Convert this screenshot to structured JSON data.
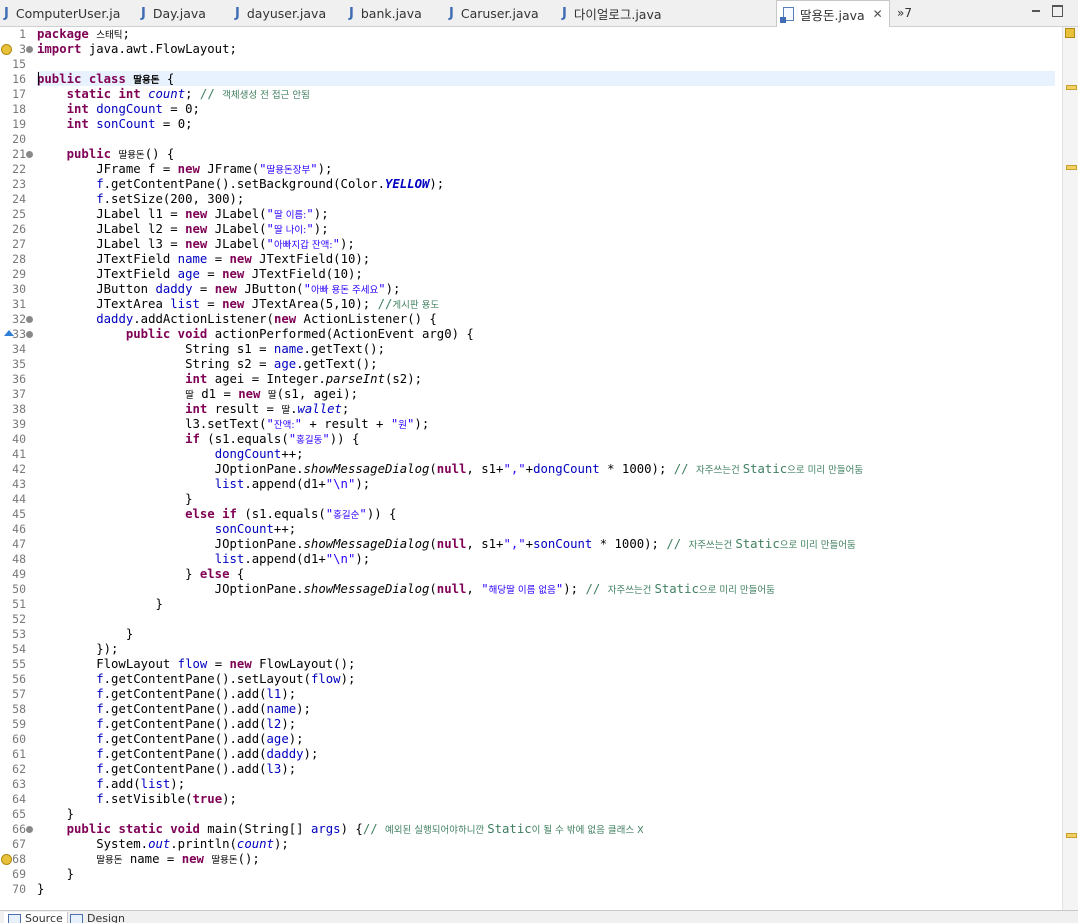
{
  "tabs": [
    {
      "label": "ComputerUser.ja",
      "active": false
    },
    {
      "label": "Day.java",
      "active": false
    },
    {
      "label": "dayuser.java",
      "active": false
    },
    {
      "label": "bank.java",
      "active": false
    },
    {
      "label": "Caruser.java",
      "active": false
    },
    {
      "label": "다이얼로그.java",
      "active": false
    },
    {
      "label": "딸용돈.java",
      "active": true
    }
  ],
  "tab_overflow": "»7",
  "tab_close_glyph": "✕",
  "java_icon_glyph": "J",
  "bottom_tabs": [
    {
      "label": "Source",
      "active": true
    },
    {
      "label": "Design",
      "active": false
    }
  ],
  "line_numbers": [
    "1",
    "3",
    "15",
    "16",
    "17",
    "18",
    "19",
    "20",
    "21",
    "22",
    "23",
    "24",
    "25",
    "26",
    "27",
    "28",
    "29",
    "30",
    "31",
    "32",
    "33",
    "34",
    "35",
    "36",
    "37",
    "38",
    "39",
    "40",
    "41",
    "42",
    "43",
    "44",
    "45",
    "46",
    "47",
    "48",
    "49",
    "50",
    "51",
    "52",
    "53",
    "54",
    "55",
    "56",
    "57",
    "58",
    "59",
    "60",
    "61",
    "62",
    "63",
    "64",
    "65",
    "66",
    "67",
    "68",
    "69",
    "70"
  ],
  "code": {
    "l1": [
      "package",
      " ",
      "스태틱",
      ";"
    ],
    "l3": [
      "import",
      " java.awt.FlowLayout;"
    ],
    "l16": [
      "public",
      " ",
      "class",
      " ",
      "딸용돈",
      " {"
    ],
    "l17": [
      "    ",
      "static",
      " ",
      "int",
      " ",
      "count",
      "; ",
      "// ",
      "객체생성 전 접근 안됨"
    ],
    "l18": [
      "    ",
      "int",
      " ",
      "dongCount",
      " = 0;"
    ],
    "l19": [
      "    ",
      "int",
      " ",
      "sonCount",
      " = 0;"
    ],
    "l21": [
      "    ",
      "public",
      " ",
      "딸용돈",
      "() {"
    ],
    "l22": [
      "        JFrame f = ",
      "new",
      " JFrame(",
      "\"",
      "딸용돈장부",
      "\"",
      ");"
    ],
    "l23": [
      "        ",
      "f",
      ".getContentPane().setBackground(Color.",
      "YELLOW",
      ");"
    ],
    "l24": [
      "        ",
      "f",
      ".setSize(200, 300);"
    ],
    "l25": [
      "        JLabel l1 = ",
      "new",
      " JLabel(",
      "\"",
      "딸 이름:",
      "\"",
      ");"
    ],
    "l26": [
      "        JLabel l2 = ",
      "new",
      " JLabel(",
      "\"",
      "딸 나이:",
      "\"",
      ");"
    ],
    "l27": [
      "        JLabel l3 = ",
      "new",
      " JLabel(",
      "\"",
      "아빠지갑 잔액:",
      "\"",
      ");"
    ],
    "l28": [
      "        JTextField ",
      "name",
      " = ",
      "new",
      " JTextField(10);"
    ],
    "l29": [
      "        JTextField ",
      "age",
      " = ",
      "new",
      " JTextField(10);"
    ],
    "l30": [
      "        JButton ",
      "daddy",
      " = ",
      "new",
      " JButton(",
      "\"",
      "아빠 용돈 주세요",
      "\"",
      ");"
    ],
    "l31": [
      "        JTextArea ",
      "list",
      " = ",
      "new",
      " JTextArea(5,10); ",
      "//",
      "게시판 용도"
    ],
    "l32": [
      "        ",
      "daddy",
      ".addActionListener(",
      "new",
      " ActionListener() {"
    ],
    "l33": [
      "            ",
      "public",
      " ",
      "void",
      " actionPerformed(ActionEvent arg0) {"
    ],
    "l34": [
      "                    String s1 = ",
      "name",
      ".getText();"
    ],
    "l35": [
      "                    String s2 = ",
      "age",
      ".getText();"
    ],
    "l36": [
      "                    ",
      "int",
      " agei = Integer.",
      "parseInt",
      "(s2);"
    ],
    "l37": [
      "                    ",
      "딸",
      " d1 = ",
      "new",
      " ",
      "딸",
      "(s1, agei);"
    ],
    "l38": [
      "                    ",
      "int",
      " result = ",
      "딸",
      ".",
      "wallet",
      ";"
    ],
    "l39": [
      "                    l3.setText(",
      "\"",
      "잔액:",
      "\"",
      " + result + ",
      "\"",
      "원",
      "\"",
      ");"
    ],
    "l40": [
      "                    ",
      "if",
      " (s1.equals(",
      "\"",
      "홍길동",
      "\"",
      ")) {"
    ],
    "l41": [
      "                        ",
      "dongCount",
      "++;"
    ],
    "l42": [
      "                        JOptionPane.",
      "showMessageDialog",
      "(",
      "null",
      ", s1+",
      "\",\"",
      "+",
      "dongCount",
      " * 1000); ",
      "// ",
      "자주쓰는건 ",
      "Static",
      "으로 미리 만들어둠"
    ],
    "l43": [
      "                        ",
      "list",
      ".append(d1+",
      "\"\\n\"",
      ");"
    ],
    "l44": [
      "                    }"
    ],
    "l45": [
      "                    ",
      "else",
      " ",
      "if",
      " (s1.equals(",
      "\"",
      "홍길순",
      "\"",
      ")) {"
    ],
    "l46": [
      "                        ",
      "sonCount",
      "++;"
    ],
    "l47": [
      "                        JOptionPane.",
      "showMessageDialog",
      "(",
      "null",
      ", s1+",
      "\",\"",
      "+",
      "sonCount",
      " * 1000); ",
      "// ",
      "자주쓰는건 ",
      "Static",
      "으로 미리 만들어둠"
    ],
    "l48": [
      "                        ",
      "list",
      ".append(d1+",
      "\"\\n\"",
      ");"
    ],
    "l49": [
      "                    } ",
      "else",
      " {"
    ],
    "l50": [
      "                        JOptionPane.",
      "showMessageDialog",
      "(",
      "null",
      ", ",
      "\"",
      "해당딸 이름 없음",
      "\"",
      "); ",
      "// ",
      "자주쓰는건 ",
      "Static",
      "으로 미리 만들어둠"
    ],
    "l51": [
      "                }"
    ],
    "l52": [
      ""
    ],
    "l53": [
      "            }"
    ],
    "l54": [
      "        });"
    ],
    "l55": [
      "        FlowLayout ",
      "flow",
      " = ",
      "new",
      " FlowLayout();"
    ],
    "l56": [
      "        ",
      "f",
      ".getContentPane().setLayout(",
      "flow",
      ");"
    ],
    "l57": [
      "        ",
      "f",
      ".getContentPane().add(",
      "l1",
      ");"
    ],
    "l58": [
      "        ",
      "f",
      ".getContentPane().add(",
      "name",
      ");"
    ],
    "l59": [
      "        ",
      "f",
      ".getContentPane().add(",
      "l2",
      ");"
    ],
    "l60": [
      "        ",
      "f",
      ".getContentPane().add(",
      "age",
      ");"
    ],
    "l61": [
      "        ",
      "f",
      ".getContentPane().add(",
      "daddy",
      ");"
    ],
    "l62": [
      "        ",
      "f",
      ".getContentPane().add(",
      "l3",
      ");"
    ],
    "l63": [
      "        ",
      "f",
      ".add(",
      "list",
      ");"
    ],
    "l64": [
      "        ",
      "f",
      ".setVisible(",
      "true",
      ");"
    ],
    "l65": [
      "    }"
    ],
    "l66": [
      "    ",
      "public",
      " ",
      "static",
      " ",
      "void",
      " main(String[] ",
      "args",
      ") {",
      "// ",
      "예외된 실행되어야하니깐 ",
      "Static",
      "이 될 수 밖에 없음 클래스 X"
    ],
    "l67": [
      "        System.",
      "out",
      ".println(",
      "count",
      ");"
    ],
    "l68": [
      "        ",
      "딸용돈",
      " ",
      "name",
      " = ",
      "new",
      " ",
      "딸용돈",
      "();"
    ],
    "l69": [
      "    }"
    ],
    "l70": [
      "}"
    ]
  },
  "colors": {
    "keyword": "#7f0055",
    "string": "#2a00ff",
    "comment": "#3f7f5f",
    "field": "#0000c0",
    "current_line": "#e8f2fe"
  },
  "icons": {
    "tab_java": "java-file-icon",
    "tab_active": "class-file-icon",
    "gutter_bulb": "lightbulb-warning-icon",
    "gutter_override": "override-triangle-icon",
    "minimize": "minimize-icon",
    "maximize": "maximize-icon"
  }
}
